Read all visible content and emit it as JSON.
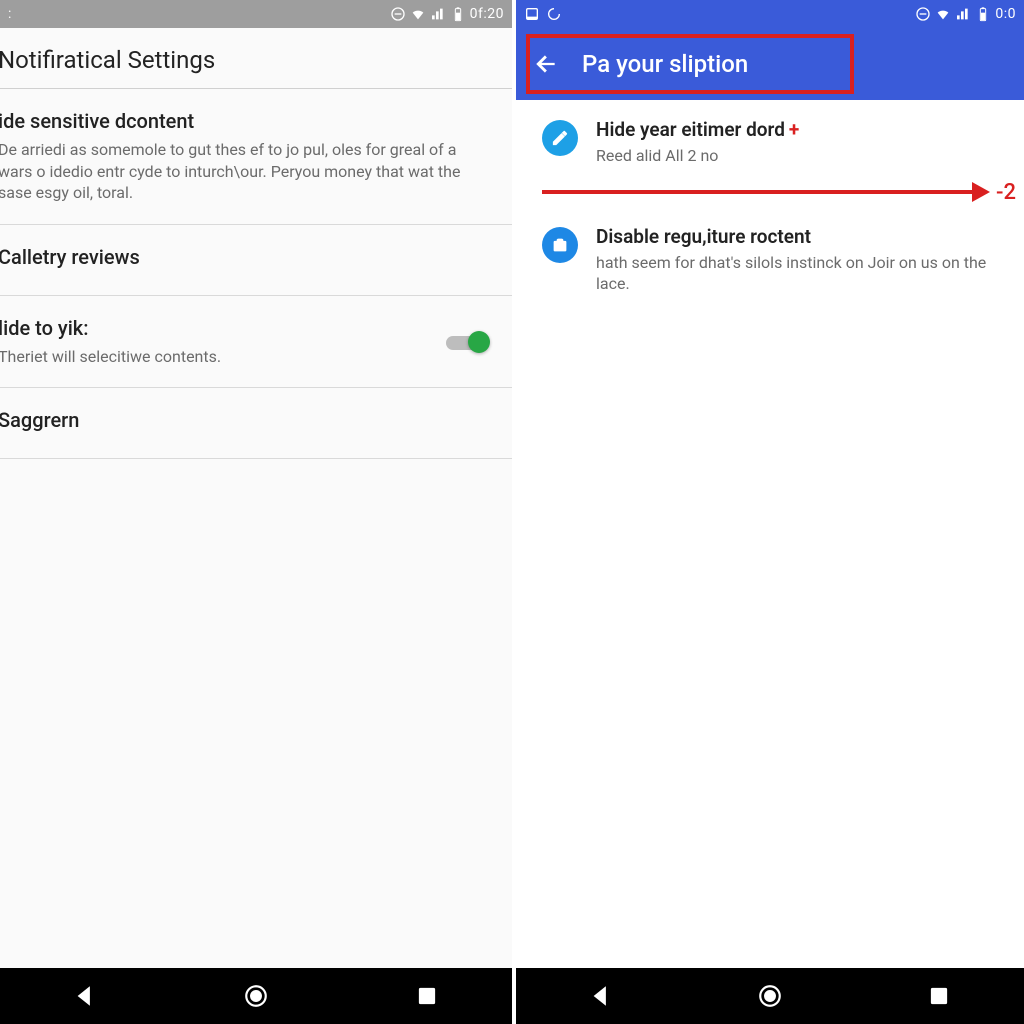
{
  "left": {
    "statusbar": {
      "time": "0f:20"
    },
    "page_title": "Notifiratical Settings",
    "sections": [
      {
        "label": "ide sensitive dcontent",
        "desc": "De arriedi as somemole to gut thes ef to jo pul, oles for greal of a wars o idedio entr cyde to inturch\\our. Peryou money that wat the sase esgy oil, toral."
      },
      {
        "label": "Calletry reviews",
        "desc": ""
      },
      {
        "label": "lide to yik:",
        "desc": "Theriet will selecitiwe contents.",
        "toggle_on": true
      },
      {
        "label": "Saggrern",
        "desc": ""
      }
    ]
  },
  "right": {
    "statusbar": {
      "time": "0:0"
    },
    "appbar_title": "Pa your sliption",
    "items": [
      {
        "icon": "pencil",
        "title": "Hide year eitimer  dord",
        "plus": "+",
        "sub": "Reed alid All 2 no"
      },
      {
        "icon": "case",
        "title": "Disable  regu,iture roctent",
        "sub": "hath seem for dhat's silols instinck on Joir on us on the lace."
      }
    ],
    "arrow_label": "-2"
  }
}
